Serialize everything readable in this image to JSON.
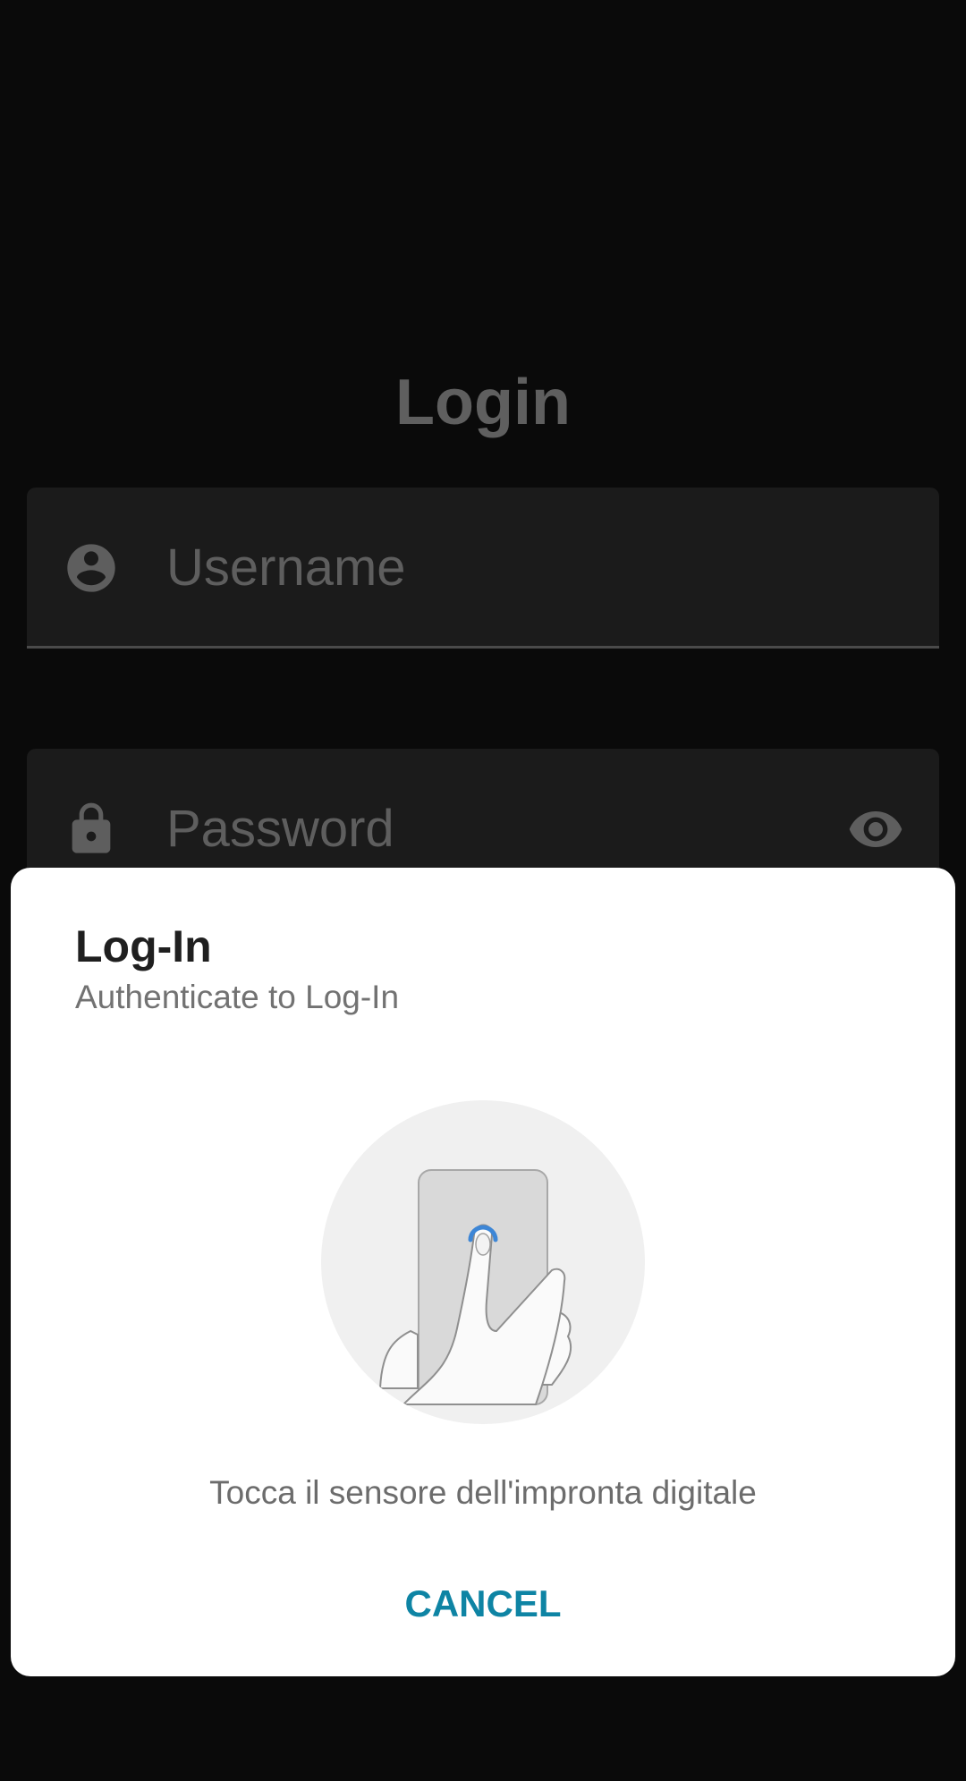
{
  "screen": {
    "title": "Login"
  },
  "fields": {
    "username": {
      "placeholder": "Username",
      "icon": "account-circle-icon"
    },
    "password": {
      "placeholder": "Password",
      "icon": "lock-icon",
      "toggle_icon": "eye-icon"
    }
  },
  "dialog": {
    "title": "Log-In",
    "subtitle": "Authenticate to Log-In",
    "illustration": "fingerprint-touch-illustration",
    "instruction": "Tocca il sensore dell'impronta digitale",
    "cancel_label": "CANCEL"
  },
  "colors": {
    "background": "#0a0a0a",
    "field_background": "#1b1b1b",
    "muted_text": "#5e5e5e",
    "dialog_background": "#ffffff",
    "accent": "#0e84a4",
    "sensor_highlight": "#3d86d6"
  }
}
